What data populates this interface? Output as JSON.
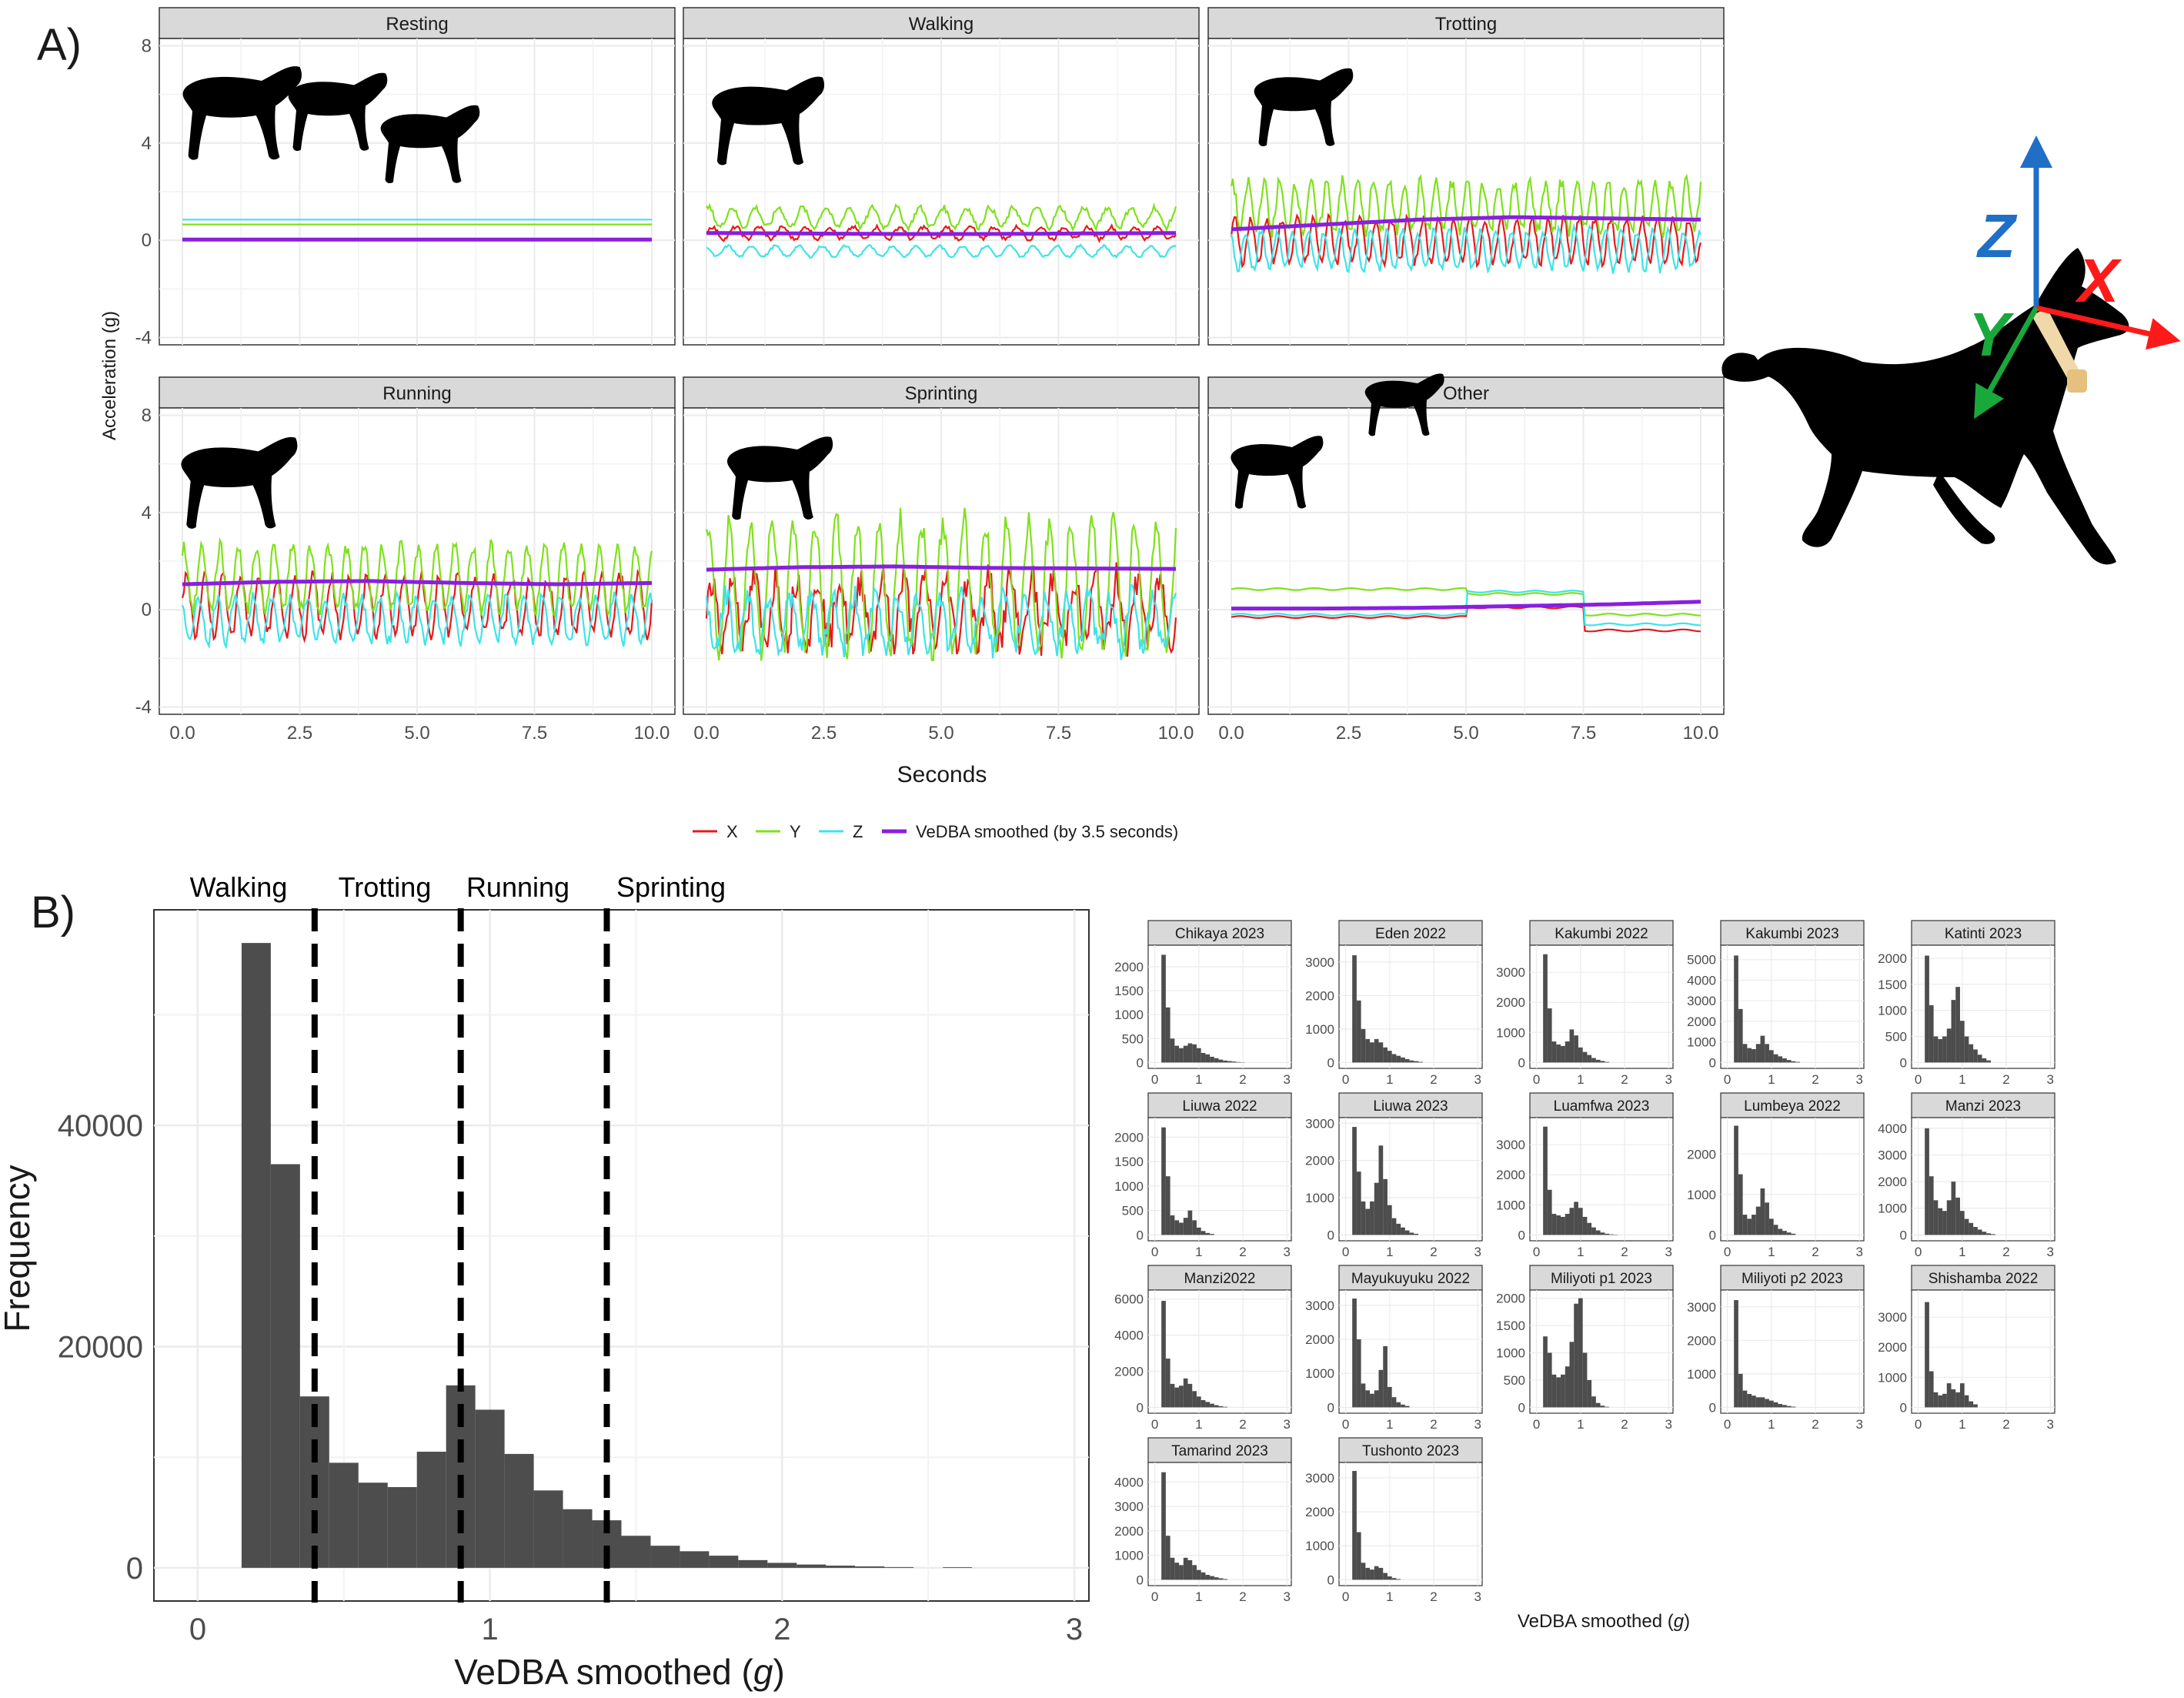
{
  "figure": {
    "panel_a_label": "A)",
    "panel_b_label": "B)"
  },
  "colors": {
    "X": "#e41a1c",
    "Y": "#7fe11c",
    "Z": "#3fe3e8",
    "VeDBA": "#8a1ee0",
    "bar": "#4d4d4d",
    "strip": "#d9d9d9",
    "grid": "#ebebeb",
    "axis_arrow_x": "#ff1a1a",
    "axis_arrow_y": "#19a83a",
    "axis_arrow_z": "#1f6fc6",
    "collar": "#f0d8a8"
  },
  "icons": [
    "dog-silhouette-icon",
    "resting-dogs-icon",
    "walking-dog-icon",
    "trotting-dog-icon",
    "running-dog-icon",
    "sprinting-dog-icon",
    "playing-dogs-icon",
    "dog-with-collar-axes-icon"
  ],
  "chart_data": [
    {
      "type": "line",
      "id": "panel-a",
      "xlabel": "Seconds",
      "ylabel": "Acceleration (g)",
      "xlim": [
        0,
        10
      ],
      "ylim": [
        -4.3,
        8.3
      ],
      "xticks": [
        "0.0",
        "2.5",
        "5.0",
        "7.5",
        "10.0"
      ],
      "yticks": [
        "-4",
        "0",
        "4",
        "8"
      ],
      "legend": {
        "position": "bottom",
        "entries": [
          {
            "key": "X",
            "label": "X"
          },
          {
            "key": "Y",
            "label": "Y"
          },
          {
            "key": "Z",
            "label": "Z"
          },
          {
            "key": "VeDBA",
            "label": "VeDBA smoothed (by 3.5 seconds)"
          }
        ]
      },
      "facets": [
        {
          "title": "Resting",
          "X": {
            "mean": 0.05,
            "amp": 0.0,
            "freq": 0,
            "noise": 0.0
          },
          "Y": {
            "mean": 0.65,
            "amp": 0.0,
            "freq": 0,
            "noise": 0.0
          },
          "Z": {
            "mean": 0.85,
            "amp": 0.0,
            "freq": 0,
            "noise": 0.0
          },
          "VeDBA": [
            0.03,
            0.03,
            0.03,
            0.03,
            0.03,
            0.03
          ]
        },
        {
          "title": "Walking",
          "X": {
            "mean": 0.3,
            "amp": 0.25,
            "freq": 2.0,
            "noise": 0.08
          },
          "Y": {
            "mean": 0.95,
            "amp": 0.4,
            "freq": 2.0,
            "noise": 0.12
          },
          "Z": {
            "mean": -0.45,
            "amp": 0.22,
            "freq": 2.0,
            "noise": 0.05
          },
          "VeDBA": [
            0.3,
            0.28,
            0.26,
            0.26,
            0.28,
            0.3
          ]
        },
        {
          "title": "Trotting",
          "X": {
            "mean": 0.0,
            "amp": 0.9,
            "freq": 3.0,
            "noise": 0.2
          },
          "Y": {
            "mean": 1.4,
            "amp": 1.0,
            "freq": 3.0,
            "noise": 0.3
          },
          "Z": {
            "mean": -0.4,
            "amp": 0.8,
            "freq": 3.0,
            "noise": 0.2
          },
          "VeDBA": [
            0.45,
            0.65,
            0.85,
            0.95,
            0.9,
            0.85
          ]
        },
        {
          "title": "Running",
          "X": {
            "mean": 0.2,
            "amp": 1.2,
            "freq": 2.6,
            "noise": 0.3
          },
          "Y": {
            "mean": 1.3,
            "amp": 1.3,
            "freq": 2.6,
            "noise": 0.3
          },
          "Z": {
            "mean": -0.4,
            "amp": 0.9,
            "freq": 2.6,
            "noise": 0.25
          },
          "VeDBA": [
            1.05,
            1.15,
            1.18,
            1.1,
            1.05,
            1.1
          ]
        },
        {
          "title": "Sprinting",
          "X": {
            "mean": 0.0,
            "amp": 1.3,
            "freq": 2.2,
            "noise": 0.7
          },
          "Y": {
            "mean": 1.0,
            "amp": 2.6,
            "freq": 2.2,
            "noise": 0.6
          },
          "Z": {
            "mean": -0.5,
            "amp": 1.1,
            "freq": 2.2,
            "noise": 0.5
          },
          "VeDBA": [
            1.65,
            1.75,
            1.78,
            1.72,
            1.7,
            1.68
          ]
        },
        {
          "title": "Other",
          "pieces": [
            {
              "from": 0,
              "to": 5,
              "X": -0.3,
              "Y": 0.85,
              "Z": -0.2
            },
            {
              "from": 5,
              "to": 7.5,
              "X": 0.1,
              "Y": 0.65,
              "Z": 0.75
            },
            {
              "from": 7.5,
              "to": 10,
              "X": -0.85,
              "Y": -0.2,
              "Z": -0.6
            }
          ],
          "VeDBA": [
            0.05,
            0.05,
            0.08,
            0.15,
            0.22,
            0.33
          ]
        }
      ]
    },
    {
      "type": "bar",
      "id": "panel-b-main",
      "xlabel": "VeDBA smoothed (g)",
      "ylabel": "Frequency",
      "xlim": [
        -0.15,
        3.05
      ],
      "ylim": [
        -3000,
        59500
      ],
      "xticks": [
        0,
        1,
        2,
        3
      ],
      "yticks": [
        0,
        20000,
        40000
      ],
      "bin_width": 0.1,
      "bin_starts": [
        0.15,
        0.25,
        0.35,
        0.45,
        0.55,
        0.65,
        0.75,
        0.85,
        0.95,
        1.05,
        1.15,
        1.25,
        1.35,
        1.45,
        1.55,
        1.65,
        1.75,
        1.85,
        1.95,
        2.05,
        2.15,
        2.25,
        2.35,
        2.55
      ],
      "values": [
        56500,
        36500,
        15500,
        9500,
        7700,
        7300,
        10500,
        16500,
        14300,
        10300,
        7000,
        5300,
        4300,
        2900,
        2000,
        1500,
        1100,
        700,
        450,
        300,
        200,
        130,
        70,
        60
      ],
      "thresholds": [
        0.4,
        0.9,
        1.4
      ],
      "zone_labels": [
        "Walking",
        "Trotting",
        "Running",
        "Sprinting"
      ]
    },
    {
      "type": "bar",
      "id": "panel-b-facets",
      "xlabel": "VeDBA smoothed (g)",
      "xlim": [
        -0.15,
        3.1
      ],
      "xticks": [
        0,
        1,
        2,
        3
      ],
      "bin_width": 0.1,
      "start": 0.15,
      "facets": [
        {
          "title": "Chikaya 2023",
          "ymax": 2450,
          "yticks": [
            0,
            500,
            1000,
            1500,
            2000
          ],
          "values": [
            2250,
            1150,
            500,
            350,
            300,
            350,
            400,
            380,
            300,
            200,
            170,
            120,
            90,
            60,
            40,
            30,
            20,
            10,
            5
          ]
        },
        {
          "title": "Eden 2022",
          "ymax": 3500,
          "yticks": [
            0,
            1000,
            2000,
            3000
          ],
          "values": [
            3200,
            1850,
            1000,
            700,
            600,
            700,
            600,
            450,
            350,
            250,
            200,
            150,
            100,
            60,
            40,
            20
          ]
        },
        {
          "title": "Kakumbi 2022",
          "ymax": 3900,
          "yticks": [
            0,
            1000,
            2000,
            3000
          ],
          "values": [
            3600,
            1800,
            700,
            600,
            550,
            700,
            1100,
            900,
            500,
            350,
            250,
            150,
            90,
            50,
            20
          ]
        },
        {
          "title": "Kakumbi 2023",
          "ymax": 5700,
          "yticks": [
            0,
            1000,
            2000,
            3000,
            4000,
            5000
          ],
          "values": [
            5200,
            2600,
            900,
            700,
            650,
            900,
            1300,
            900,
            600,
            400,
            300,
            200,
            120,
            60,
            30
          ]
        },
        {
          "title": "Katinti 2023",
          "ymax": 2250,
          "yticks": [
            0,
            500,
            1000,
            1500,
            2000
          ],
          "values": [
            2050,
            1100,
            500,
            450,
            500,
            650,
            1200,
            1450,
            800,
            500,
            350,
            250,
            150,
            80,
            40
          ]
        },
        {
          "title": "Liuwa 2022",
          "ymax": 2400,
          "yticks": [
            0,
            500,
            1000,
            1500,
            2000
          ],
          "values": [
            2200,
            1200,
            400,
            300,
            250,
            350,
            500,
            300,
            150,
            80,
            40,
            20
          ]
        },
        {
          "title": "Liuwa 2023",
          "ymax": 3150,
          "yticks": [
            0,
            1000,
            2000,
            3000
          ],
          "values": [
            2900,
            1700,
            900,
            700,
            900,
            1400,
            2400,
            1500,
            800,
            450,
            300,
            200,
            120,
            60,
            30
          ]
        },
        {
          "title": "Luamfwa 2023",
          "ymax": 3900,
          "yticks": [
            0,
            1000,
            2000,
            3000
          ],
          "values": [
            3600,
            1500,
            700,
            650,
            600,
            700,
            900,
            1100,
            900,
            600,
            400,
            250,
            150,
            80,
            40,
            20,
            10
          ]
        },
        {
          "title": "Lumbeya 2022",
          "ymax": 2900,
          "yticks": [
            0,
            1000,
            2000
          ],
          "values": [
            2700,
            1500,
            500,
            400,
            500,
            700,
            1150,
            800,
            400,
            250,
            150,
            100,
            60,
            30
          ]
        },
        {
          "title": "Manzi 2023",
          "ymax": 4400,
          "yticks": [
            0,
            1000,
            2000,
            3000,
            4000
          ],
          "values": [
            4000,
            2200,
            1300,
            1000,
            900,
            1300,
            2000,
            1400,
            900,
            600,
            450,
            300,
            200,
            120,
            60,
            30
          ]
        },
        {
          "title": "Manzi2022",
          "ymax": 6500,
          "yticks": [
            0,
            2000,
            4000,
            6000
          ],
          "values": [
            5900,
            2700,
            1300,
            1100,
            1200,
            1600,
            1300,
            900,
            600,
            400,
            300,
            200,
            120,
            60,
            30
          ]
        },
        {
          "title": "Mayukuyuku 2022",
          "ymax": 3450,
          "yticks": [
            0,
            1000,
            2000,
            3000
          ],
          "values": [
            3200,
            2000,
            700,
            500,
            400,
            500,
            1100,
            1800,
            600,
            300,
            150,
            80,
            40
          ]
        },
        {
          "title": "Miliyoti p1 2023",
          "ymax": 2150,
          "yticks": [
            0,
            500,
            1000,
            1500,
            2000
          ],
          "values": [
            1300,
            1000,
            600,
            550,
            600,
            750,
            1200,
            1900,
            2000,
            1000,
            500,
            200,
            80,
            30,
            10
          ]
        },
        {
          "title": "Miliyoti p2 2023",
          "ymax": 3500,
          "yticks": [
            0,
            1000,
            2000,
            3000
          ],
          "values": [
            3200,
            1000,
            500,
            400,
            350,
            300,
            300,
            250,
            200,
            150,
            100,
            70,
            40,
            20
          ]
        },
        {
          "title": "Shishamba 2022",
          "ymax": 3900,
          "yticks": [
            0,
            1000,
            2000,
            3000
          ],
          "values": [
            3500,
            1200,
            500,
            400,
            450,
            800,
            600,
            500,
            800,
            400,
            200,
            100
          ]
        },
        {
          "title": "Tamarind 2023",
          "ymax": 4800,
          "yticks": [
            0,
            1000,
            2000,
            3000,
            4000
          ],
          "values": [
            4400,
            1800,
            900,
            700,
            600,
            900,
            800,
            600,
            400,
            300,
            200,
            150,
            100,
            60,
            30
          ]
        },
        {
          "title": "Tushonto 2023",
          "ymax": 3450,
          "yticks": [
            0,
            1000,
            2000,
            3000
          ],
          "values": [
            3200,
            1400,
            500,
            350,
            300,
            400,
            350,
            200,
            100,
            50,
            20
          ]
        }
      ]
    }
  ],
  "axis_diagram": {
    "x_label": "X",
    "y_label": "Y",
    "z_label": "Z"
  }
}
